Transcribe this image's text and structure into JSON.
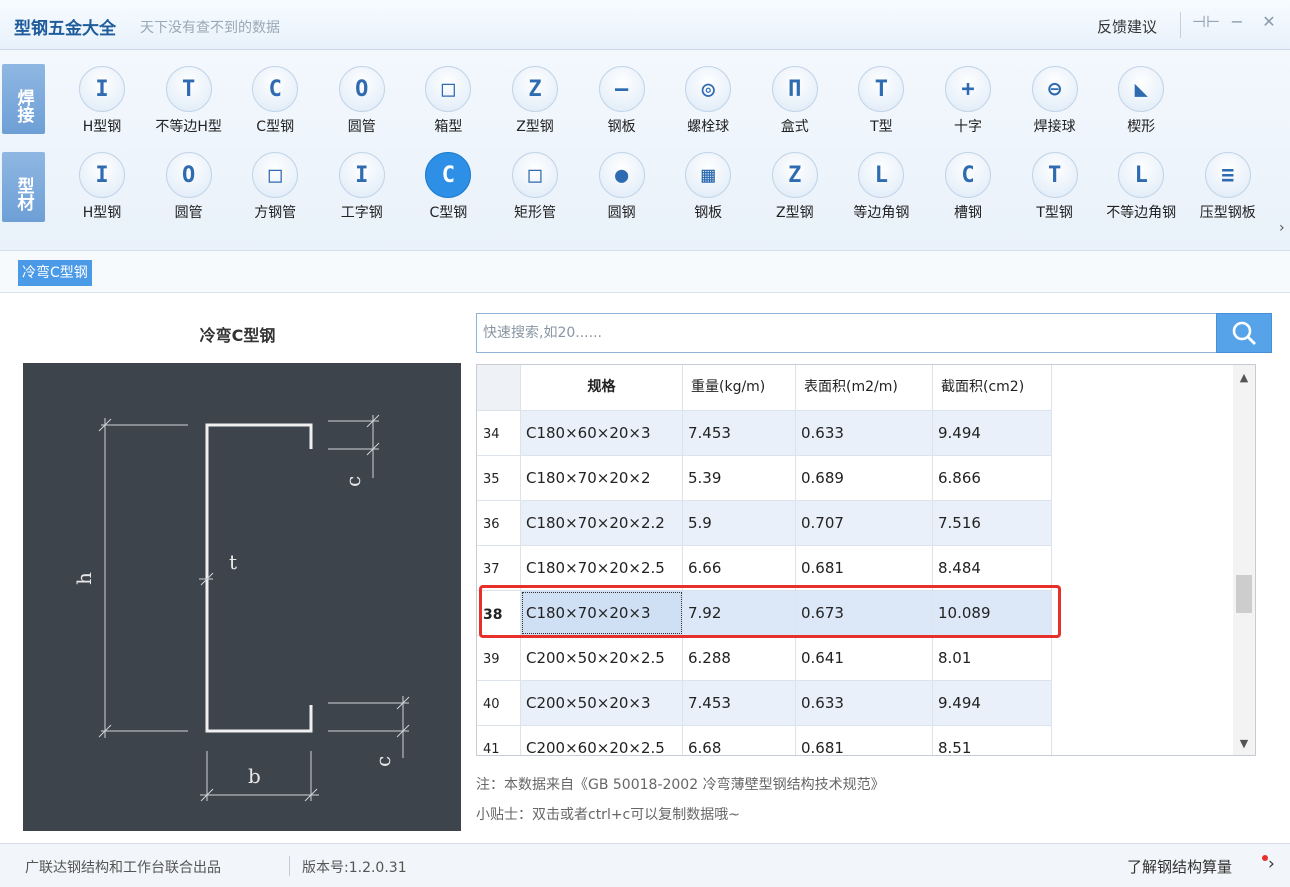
{
  "title_bar": {
    "app_name": "型钢五金大全",
    "slogan": "天下没有查不到的数据",
    "feedback": "反馈建议",
    "pin_glyph": "⊣⊢",
    "minimize_glyph": "−",
    "close_glyph": "✕"
  },
  "toolbar": {
    "categories": [
      "焊接",
      "型材"
    ],
    "weld_items": [
      {
        "label": "H型钢",
        "icon": "h-beam-icon",
        "glyph": "I"
      },
      {
        "label": "不等边H型",
        "icon": "unequal-h-icon",
        "glyph": "T"
      },
      {
        "label": "C型钢",
        "icon": "c-channel-icon",
        "glyph": "C"
      },
      {
        "label": "圆管",
        "icon": "round-pipe-icon",
        "glyph": "O"
      },
      {
        "label": "箱型",
        "icon": "box-section-icon",
        "glyph": "□"
      },
      {
        "label": "Z型钢",
        "icon": "z-section-icon",
        "glyph": "Z"
      },
      {
        "label": "钢板",
        "icon": "steel-plate-icon",
        "glyph": "—"
      },
      {
        "label": "螺栓球",
        "icon": "bolt-ball-icon",
        "glyph": "◎"
      },
      {
        "label": "盒式",
        "icon": "box-type-icon",
        "glyph": "Π"
      },
      {
        "label": "T型",
        "icon": "t-section-icon",
        "glyph": "T"
      },
      {
        "label": "十字",
        "icon": "cross-section-icon",
        "glyph": "+"
      },
      {
        "label": "焊接球",
        "icon": "weld-ball-icon",
        "glyph": "⊖"
      },
      {
        "label": "楔形",
        "icon": "wedge-icon",
        "glyph": "◣"
      }
    ],
    "profile_items": [
      {
        "label": "H型钢",
        "icon": "h-beam-icon",
        "glyph": "I"
      },
      {
        "label": "圆管",
        "icon": "round-pipe-icon",
        "glyph": "O"
      },
      {
        "label": "方钢管",
        "icon": "square-tube-icon",
        "glyph": "□"
      },
      {
        "label": "工字钢",
        "icon": "i-beam-icon",
        "glyph": "I"
      },
      {
        "label": "C型钢",
        "icon": "c-channel-icon",
        "glyph": "C",
        "active": true
      },
      {
        "label": "矩形管",
        "icon": "rect-tube-icon",
        "glyph": "□"
      },
      {
        "label": "圆钢",
        "icon": "round-bar-icon",
        "glyph": "●"
      },
      {
        "label": "钢板",
        "icon": "steel-plate-icon",
        "glyph": "▦"
      },
      {
        "label": "Z型钢",
        "icon": "z-section-icon",
        "glyph": "Z"
      },
      {
        "label": "等边角钢",
        "icon": "equal-angle-icon",
        "glyph": "L"
      },
      {
        "label": "槽钢",
        "icon": "channel-icon",
        "glyph": "C"
      },
      {
        "label": "T型钢",
        "icon": "t-section-icon",
        "glyph": "T"
      },
      {
        "label": "不等边角钢",
        "icon": "unequal-angle-icon",
        "glyph": "L"
      },
      {
        "label": "压型钢板",
        "icon": "profiled-sheet-icon",
        "glyph": "≡"
      }
    ],
    "more_glyph": "›"
  },
  "subtab": {
    "label": "冷弯C型钢"
  },
  "figure": {
    "title": "冷弯C型钢",
    "labels": {
      "h": "h",
      "t": "t",
      "b": "b",
      "c": "c"
    }
  },
  "search": {
    "placeholder": "快速搜索,如20......"
  },
  "table": {
    "headers": [
      "规格",
      "重量(kg/m)",
      "表面积(m2/m)",
      "截面积(cm2)"
    ],
    "rows": [
      {
        "idx": "34",
        "spec": "C180×60×20×3",
        "weight": "7.453",
        "surface": "0.633",
        "area": "9.494"
      },
      {
        "idx": "35",
        "spec": "C180×70×20×2",
        "weight": "5.39",
        "surface": "0.689",
        "area": "6.866"
      },
      {
        "idx": "36",
        "spec": "C180×70×20×2.2",
        "weight": "5.9",
        "surface": "0.707",
        "area": "7.516"
      },
      {
        "idx": "37",
        "spec": "C180×70×20×2.5",
        "weight": "6.66",
        "surface": "0.681",
        "area": "8.484"
      },
      {
        "idx": "38",
        "spec": "C180×70×20×3",
        "weight": "7.92",
        "surface": "0.673",
        "area": "10.089",
        "selected": true
      },
      {
        "idx": "39",
        "spec": "C200×50×20×2.5",
        "weight": "6.288",
        "surface": "0.641",
        "area": "8.01"
      },
      {
        "idx": "40",
        "spec": "C200×50×20×3",
        "weight": "7.453",
        "surface": "0.633",
        "area": "9.494"
      },
      {
        "idx": "41",
        "spec": "C200×60×20×2.5",
        "weight": "6.68",
        "surface": "0.681",
        "area": "8.51"
      }
    ]
  },
  "notes": {
    "source": "注：本数据来自《GB  50018-2002  冷弯薄壁型钢结构技术规范》",
    "tip": "小贴士：双击或者ctrl+c可以复制数据哦~"
  },
  "status": {
    "publisher": "广联达钢结构和工作台联合出品",
    "version": "版本号:1.2.0.31",
    "link": "了解钢结构算量",
    "link_glyph": "›"
  }
}
